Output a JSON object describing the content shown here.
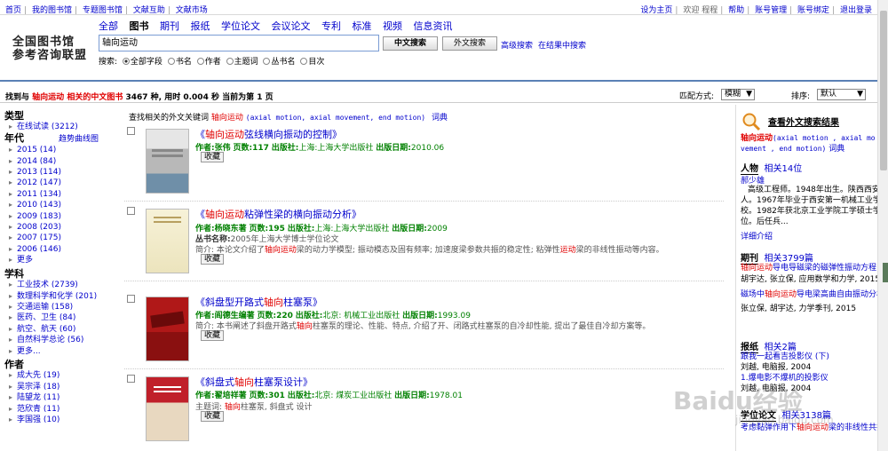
{
  "topbar": {
    "left": [
      "首页",
      "我的图书馆",
      "专题图书馆",
      "文献互助",
      "文献市场"
    ],
    "right_set_home": "设为主页",
    "right_welcome": "欢迎",
    "right_user": "程程",
    "right_help": "帮助",
    "right_account": "账号管理",
    "right_bind": "账号绑定",
    "right_logout": "退出登录"
  },
  "logo": {
    "line1": "全国图书馆",
    "line2": "参考咨询联盟"
  },
  "channels": [
    "全部",
    "图书",
    "期刊",
    "报纸",
    "学位论文",
    "会议论文",
    "专利",
    "标准",
    "视频",
    "信息资讯"
  ],
  "active_channel": "图书",
  "search": {
    "value": "轴向运动",
    "btn_cn": "中文搜索",
    "btn_en": "外文搜索",
    "advanced": "高级搜索",
    "within": "在结果中搜索",
    "label": "搜索:",
    "options": [
      "全部字段",
      "书名",
      "作者",
      "主题词",
      "丛书名",
      "目次"
    ]
  },
  "status": {
    "prefix": "找到与",
    "keyword": "轴向运动",
    "mid": "相关的中文图书",
    "count": "3467",
    "rest": "种, 用时 0.004 秒 当前为第 1 页",
    "match_label": "匹配方式:",
    "match_value": "模糊",
    "sort_label": "排序:",
    "sort_value": "默认"
  },
  "left": {
    "type_title": "类型",
    "types": [
      "在线试读 (3212)"
    ],
    "year_title": "年代",
    "trend": "趋势曲线图",
    "years": [
      "2015 (14)",
      "2014 (84)",
      "2013 (114)",
      "2012 (147)",
      "2011 (134)",
      "2010 (143)",
      "2009 (183)",
      "2008 (203)",
      "2007 (175)",
      "2006 (146)",
      "更多"
    ],
    "subject_title": "学科",
    "subjects": [
      "工业技术 (2739)",
      "数理科学和化学 (201)",
      "交通运输 (158)",
      "医药、卫生 (84)",
      "航空、航天 (60)",
      "自然科学总论 (56)",
      "更多..."
    ],
    "author_title": "作者",
    "authors": [
      "成大先 (19)",
      "吴宗泽 (18)",
      "陆望龙 (11)",
      "范欣青 (11)",
      "李国强 (10)"
    ]
  },
  "related": {
    "label": "查找相关的外文关键词",
    "keyword": "轴向运动",
    "terms": "(axial motion, axial movement, end motion)",
    "dict": "词典"
  },
  "records": [
    {
      "title_pre": "《",
      "title_hl": "轴向运动",
      "title_post": "弦线横向振动的控制》",
      "author": "作者:张伟",
      "pages": "页数:117",
      "publisher_label": "出版社:",
      "publisher": "上海:上海大学出版社",
      "date_label": "出版日期:",
      "date": "2010.06",
      "extra_label": "",
      "extra": "",
      "abstract": "",
      "collect": "收藏"
    },
    {
      "title_pre": "《",
      "title_hl": "轴向运动",
      "title_post": "粘弹性梁的横向振动分析》",
      "author": "作者:杨晓东著",
      "pages": "页数:195",
      "publisher_label": "出版社:",
      "publisher": "上海:上海大学出版社",
      "date_label": "出版日期:",
      "date": "2009",
      "extra_label": "丛书名称:",
      "extra": "2005年上海大学博士学位论文",
      "abstract_pre": "简介: 本论文介绍了",
      "abstract_hl": "轴向运动",
      "abstract_mid": "梁的动力学模型; 振动模态及固有频率; 加速度梁参数共振的稳定性; 粘弹性",
      "abstract_hl2": "运动",
      "abstract_post": "梁的非线性振动等内容。",
      "collect": "收藏"
    },
    {
      "title_pre": "《斜盘型开路式",
      "title_hl": "轴向",
      "title_post": "柱塞泵》",
      "author": "作者:阎德生编著",
      "pages": "页数:220",
      "publisher_label": "出版社:",
      "publisher": "北京: 机械工业出版社",
      "date_label": "出版日期:",
      "date": "1993.09",
      "abstract_pre": "简介: 本书阐述了斜盘开路式",
      "abstract_hl": "轴向",
      "abstract_mid": "柱塞泵的理论、性能、特点, 介绍了开、闭路式柱塞泵的自冷却性能, 提出了最佳自冷却方案等。",
      "abstract_hl2": "",
      "abstract_post": "",
      "collect": "收藏"
    },
    {
      "title_pre": "《斜盘式",
      "title_hl": "轴向",
      "title_post": "柱塞泵设计》",
      "author": "作者:翟培祥著",
      "pages": "页数:301",
      "publisher_label": "出版社:",
      "publisher": "北京: 煤炭工业出版社",
      "date_label": "出版日期:",
      "date": "1978.01",
      "subject_pre": "主题词: ",
      "subject_hl": "轴向",
      "subject_post": "柱塞泵, 斜盘式   设计",
      "collect": "收藏"
    }
  ],
  "right": {
    "title": "查看外文搜索结果",
    "kw_hl": "轴向运动",
    "kw_en": "(axial motion , axial movement , end motion)",
    "dict": "词典",
    "person_title": "人物",
    "person_count": "相关14位",
    "person_name": "郝少雄",
    "person_bio": [
      "高级工程师。1948年出生。陕西西安",
      "人。1967年毕业于西安第一机械工业学",
      "校。1982年获北京工业学院工学硕士学",
      "位。后任兵..."
    ],
    "person_more": "详细介绍",
    "journal_title": "期刊",
    "journal_count": "相关3799篇",
    "journal_items": [
      {
        "pre": "",
        "hl": "轴向运动",
        "post": "导电导磁梁的磁弹性振动方程",
        "meta": "胡宇达, 张立保, 应用数学和力学, 2015"
      },
      {
        "pre": "磁场中",
        "hl": "轴向运动",
        "post": "导电梁高曲自由振动分析",
        "meta": "张立保, 胡宇达, 力学季刊, 2015"
      }
    ],
    "paper_title": "报纸",
    "paper_count": "相关2篇",
    "paper_items": [
      "跟我一起看吉投影仪 (下)",
      "刘越, 电脑报, 2004",
      "1.爆电影不爆机的投影仪",
      "刘越, 电脑报, 2004"
    ],
    "thesis_title": "学位论文",
    "thesis_count": "相关3138篇",
    "thesis_item_pre": "考虑黏弹作用下",
    "thesis_item_hl": "轴向运动",
    "thesis_item_post": "梁的非线性共振"
  },
  "watermark": {
    "main": "Baidu经验",
    "sub": "jingyan.baidu.com"
  }
}
